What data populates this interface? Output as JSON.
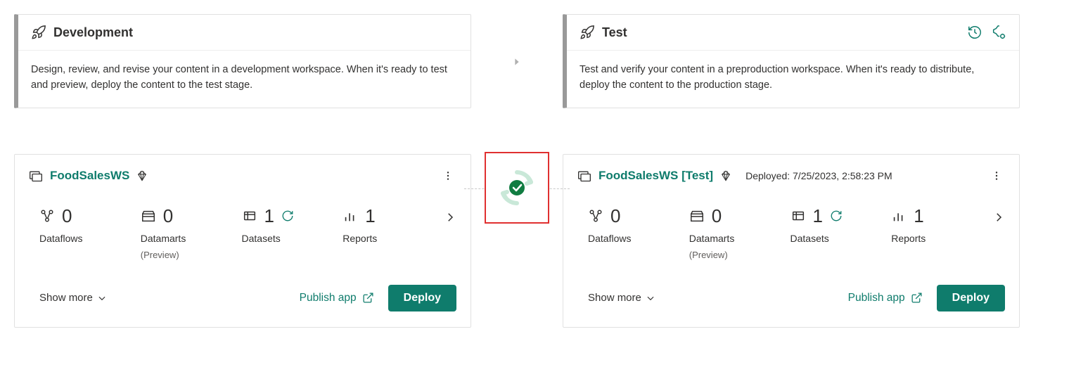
{
  "stages": [
    {
      "title": "Development",
      "description": "Design, review, and revise your content in a development workspace. When it's ready to test and preview, deploy the content to the test stage."
    },
    {
      "title": "Test",
      "description": "Test and verify your content in a preproduction workspace. When it's ready to distribute, deploy the content to the production stage."
    }
  ],
  "workspaces": [
    {
      "name": "FoodSalesWS",
      "deployed": "",
      "metrics": {
        "dataflows": {
          "value": "0",
          "label": "Dataflows"
        },
        "datamarts": {
          "value": "0",
          "label": "Datamarts",
          "sublabel": "(Preview)"
        },
        "datasets": {
          "value": "1",
          "label": "Datasets"
        },
        "reports": {
          "value": "1",
          "label": "Reports"
        }
      },
      "show_more": "Show more",
      "publish_app": "Publish app",
      "deploy": "Deploy"
    },
    {
      "name": "FoodSalesWS [Test]",
      "deployed": "Deployed: 7/25/2023, 2:58:23 PM",
      "metrics": {
        "dataflows": {
          "value": "0",
          "label": "Dataflows"
        },
        "datamarts": {
          "value": "0",
          "label": "Datamarts",
          "sublabel": "(Preview)"
        },
        "datasets": {
          "value": "1",
          "label": "Datasets"
        },
        "reports": {
          "value": "1",
          "label": "Reports"
        }
      },
      "show_more": "Show more",
      "publish_app": "Publish app",
      "deploy": "Deploy"
    }
  ]
}
